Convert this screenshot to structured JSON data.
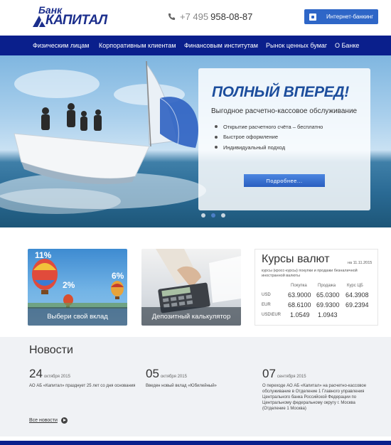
{
  "header": {
    "logo_top": "Банк",
    "logo_main": "КАПИТАЛ",
    "phone_code": "+7 495",
    "phone_number": "958-08-87",
    "ibank_label": "Интернет-банкинг"
  },
  "nav": {
    "items": [
      {
        "label": "Физическим лицам"
      },
      {
        "label": "Корпоративным клиентам"
      },
      {
        "label": "Финансовым институтам"
      },
      {
        "label": "Рынок ценных бумаг"
      },
      {
        "label": "О Банке"
      }
    ]
  },
  "hero": {
    "title": "ПОЛНЫЙ ВПЕРЕД!",
    "subtitle": "Выгодное расчетно-кассовое обслуживание",
    "bullets": [
      "Открытие расчетного счёта – бесплатно",
      "Быстрое оформление",
      "Индивидуальный подход"
    ],
    "button_label": "Подробнее...",
    "slides_total": 3,
    "active_slide": 1
  },
  "cards": [
    {
      "label": "Выбери свой вклад",
      "badges": [
        "11%",
        "2%",
        "6%"
      ]
    },
    {
      "label": "Депозитный калькулятор"
    }
  ],
  "rates": {
    "title": "Курсы валют",
    "date": "на 11.11.2015",
    "description": "курсы (кросс-курсы) покупки и продажи безналичной иностранной валюты",
    "columns": [
      "Покупка",
      "Продажа",
      "Курс ЦБ"
    ],
    "rows": [
      {
        "currency": "USD",
        "buy": "63.9000",
        "sell": "65.0300",
        "cb": "64.3908"
      },
      {
        "currency": "EUR",
        "buy": "68.6100",
        "sell": "69.9300",
        "cb": "69.2394"
      },
      {
        "currency": "USD\\EUR",
        "buy": "1.0549",
        "sell": "1.0943",
        "cb": ""
      }
    ]
  },
  "news": {
    "title": "Новости",
    "items": [
      {
        "day": "24",
        "month": "октября 2015",
        "text": "АО АБ «Капитал» празднует 25 лет со дня основания"
      },
      {
        "day": "05",
        "month": "октября 2015",
        "text": "Введен новый вклад «Юбилейный»"
      },
      {
        "day": "07",
        "month": "сентября 2015",
        "text": "О переходе АО АБ «Капитал» на расчетно-кассовое обслуживание в Отделение 1 Главного управления Центрального банка Российской Федерации по Центральному федеральному округу г. Москва (Отделение 1 Москва)"
      }
    ],
    "all_label": "Все новости"
  },
  "colors": {
    "nav_bg": "#0a1f8c",
    "accent": "#2e66c7",
    "promo_title": "#1c4d9c"
  }
}
